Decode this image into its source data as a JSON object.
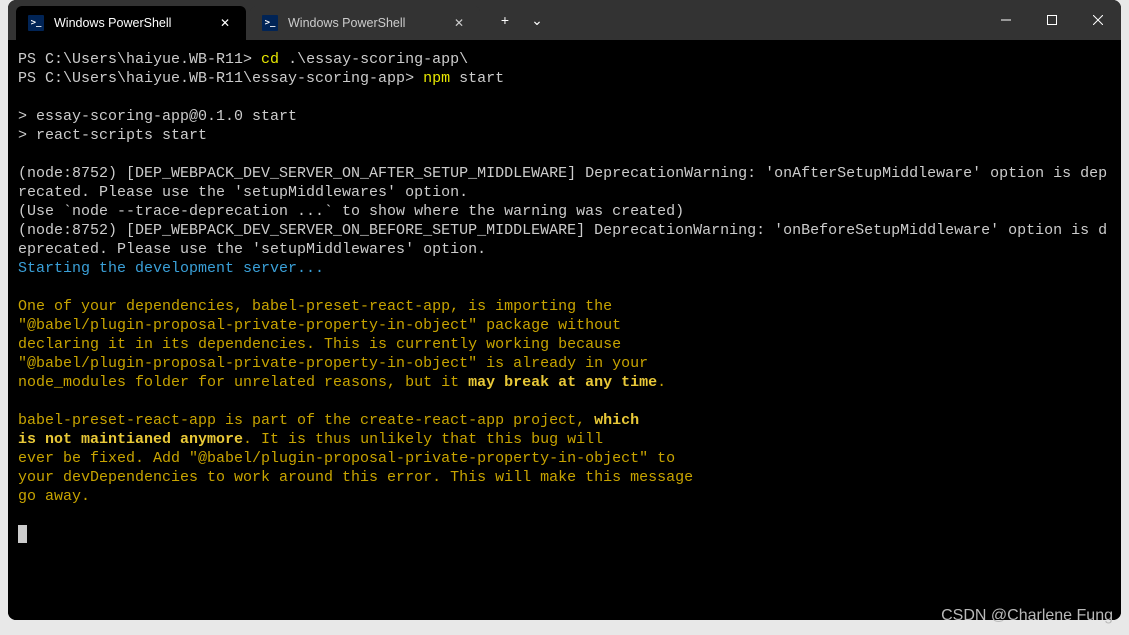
{
  "window": {
    "tabs": [
      {
        "title": "Windows PowerShell",
        "active": true
      },
      {
        "title": "Windows PowerShell",
        "active": false
      }
    ],
    "newTabLabel": "+",
    "dropdownLabel": "⌄"
  },
  "terminal": {
    "line1_prompt": "PS C:\\Users\\haiyue.WB-R11> ",
    "line1_cmd": "cd ",
    "line1_arg": ".\\essay-scoring-app\\",
    "line2_prompt": "PS C:\\Users\\haiyue.WB-R11\\essay-scoring-app> ",
    "line2_cmd": "npm ",
    "line2_arg": "start",
    "block1": "> essay-scoring-app@0.1.0 start\n> react-scripts start",
    "block2": "(node:8752) [DEP_WEBPACK_DEV_SERVER_ON_AFTER_SETUP_MIDDLEWARE] DeprecationWarning: 'onAfterSetupMiddleware' option is deprecated. Please use the 'setupMiddlewares' option.\n(Use `node --trace-deprecation ...` to show where the warning was created)\n(node:8752) [DEP_WEBPACK_DEV_SERVER_ON_BEFORE_SETUP_MIDDLEWARE] DeprecationWarning: 'onBeforeSetupMiddleware' option is deprecated. Please use the 'setupMiddlewares' option.",
    "starting": "Starting the development server...",
    "warn1_a": "One of your dependencies, babel-preset-react-app, is importing the\n\"@babel/plugin-proposal-private-property-in-object\" package without\ndeclaring it in its dependencies. This is currently working because\n\"@babel/plugin-proposal-private-property-in-object\" is already in your\nnode_modules folder for unrelated reasons, but it ",
    "warn1_bold": "may break at any time",
    "warn1_dot": ".",
    "warn2_a": "babel-preset-react-app is part of the create-react-app project, ",
    "warn2_bold": "which\nis not maintianed anymore",
    "warn2_rest": ". It is thus unlikely that this bug will\never be fixed. Add \"@babel/plugin-proposal-private-property-in-object\" to\nyour devDependencies to work around this error. This will make this message\ngo away."
  },
  "watermark": "CSDN @Charlene Fung"
}
